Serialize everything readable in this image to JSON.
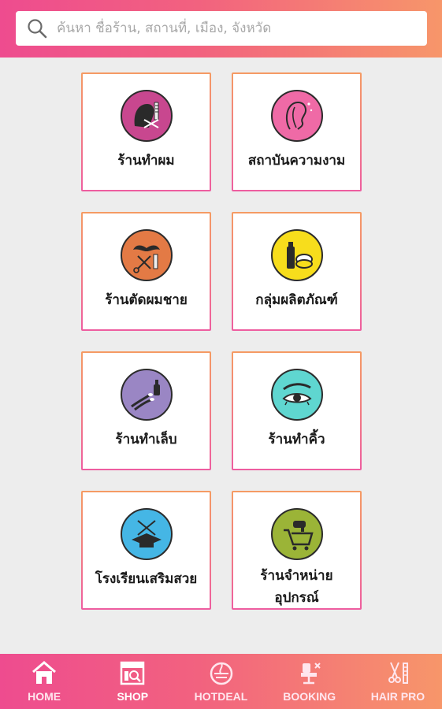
{
  "search": {
    "placeholder": "ค้นหา ชื่อร้าน, สถานที่, เมือง, จังหวัด",
    "value": ""
  },
  "categories": [
    {
      "label": "ร้านทำผม",
      "icon": "hair-salon-icon",
      "color": "#c8478f"
    },
    {
      "label": "สถาบันความงาม",
      "icon": "beauty-face-icon",
      "color": "#ef6aa6"
    },
    {
      "label": "ร้านตัดผมชาย",
      "icon": "barber-mustache-icon",
      "color": "#e37a45"
    },
    {
      "label": "กลุ่มผลิตภัณฑ์",
      "icon": "products-icon",
      "color": "#f7dd1c"
    },
    {
      "label": "ร้านทำเล็บ",
      "icon": "nail-polish-icon",
      "color": "#9a86c4"
    },
    {
      "label": "ร้านทำคิ้ว",
      "icon": "eyebrow-eye-icon",
      "color": "#5fd6d0"
    },
    {
      "label": "โรงเรียนเสริมสวย",
      "icon": "beauty-school-icon",
      "color": "#45b6e5"
    },
    {
      "label": "ร้านจำหน่าย\nอุปกรณ์",
      "icon": "equipment-cart-icon",
      "color": "#9bb437"
    }
  ],
  "nav": [
    {
      "label": "HOME",
      "icon": "home-icon",
      "active": false
    },
    {
      "label": "SHOP",
      "icon": "shop-icon",
      "active": true
    },
    {
      "label": "HOTDEAL",
      "icon": "hotdeal-icon",
      "active": false
    },
    {
      "label": "BOOKING",
      "icon": "booking-chair-icon",
      "active": false
    },
    {
      "label": "HAIR PRO",
      "icon": "hair-pro-scissors-icon",
      "active": false
    }
  ]
}
